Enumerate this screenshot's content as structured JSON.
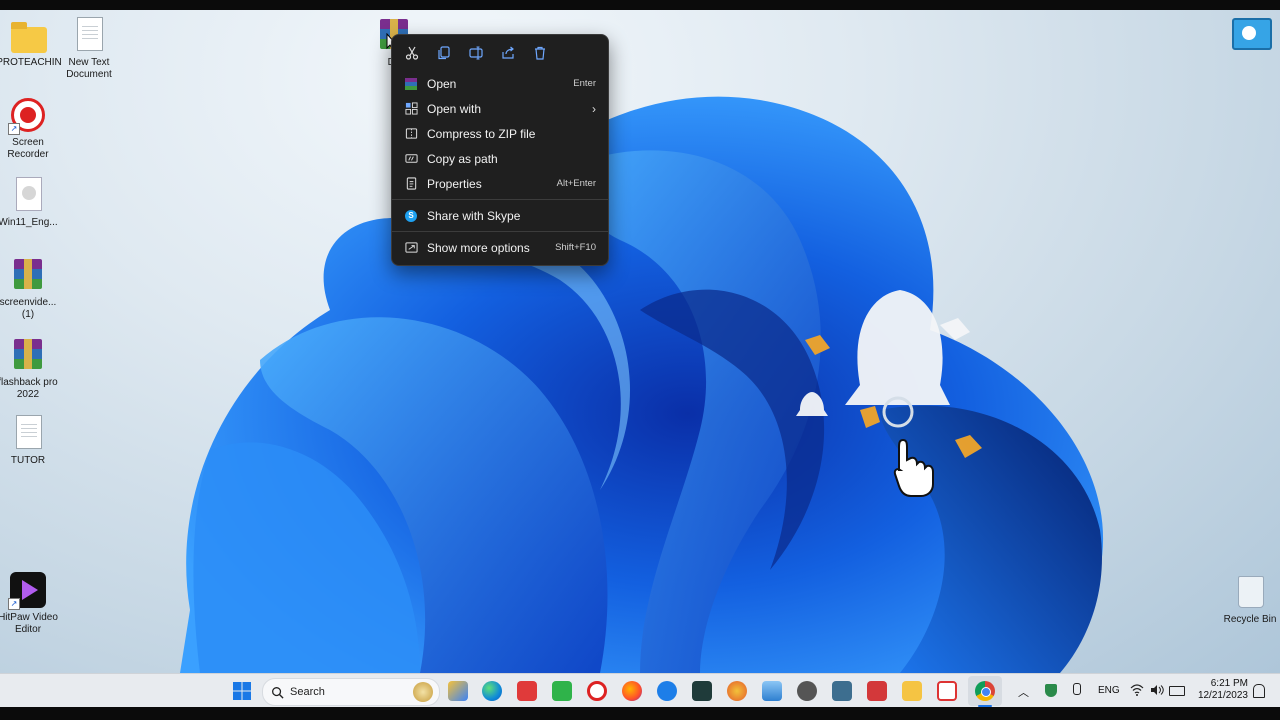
{
  "desktop": {
    "icons": [
      {
        "label": "PROTEACHIN",
        "kind": "folder"
      },
      {
        "label": "New Text\nDocument",
        "kind": "doc"
      },
      {
        "label": "Screen\nRecorder",
        "kind": "recorder"
      },
      {
        "label": "Win11_Eng...",
        "kind": "disc"
      },
      {
        "label": "screenvide...\n(1)",
        "kind": "archive"
      },
      {
        "label": "flashback pro\n2022",
        "kind": "archive"
      },
      {
        "label": "TUTOR",
        "kind": "doc"
      },
      {
        "label": "HitPaw Video\nEditor",
        "kind": "hitpaw"
      },
      {
        "label": "Dri",
        "kind": "archive"
      },
      {
        "label": "Recycle Bin",
        "kind": "bin"
      }
    ]
  },
  "context_menu": {
    "toolbar": [
      "cut-icon",
      "copy-icon",
      "rename-icon",
      "share-icon",
      "delete-icon"
    ],
    "items": [
      {
        "label": "Open",
        "shortcut": "Enter",
        "icon": "archive-icon"
      },
      {
        "label": "Open with",
        "shortcut": "",
        "icon": "open-with-icon",
        "submenu": "›"
      },
      {
        "label": "Compress to ZIP file",
        "shortcut": "",
        "icon": "zip-icon"
      },
      {
        "label": "Copy as path",
        "shortcut": "",
        "icon": "copy-path-icon"
      },
      {
        "label": "Properties",
        "shortcut": "Alt+Enter",
        "icon": "properties-icon"
      },
      {
        "label": "Share with Skype",
        "shortcut": "",
        "icon": "skype-icon"
      },
      {
        "label": "Show more options",
        "shortcut": "Shift+F10",
        "icon": "more-options-icon"
      }
    ]
  },
  "taskbar": {
    "search_label": "Search",
    "language": "ENG",
    "time": "6:21 PM",
    "date": "12/21/2023"
  },
  "colors": {
    "menu_bg": "#1f1f1f",
    "taskbar_bg": "#e8ebef",
    "accent": "#1763d6"
  }
}
